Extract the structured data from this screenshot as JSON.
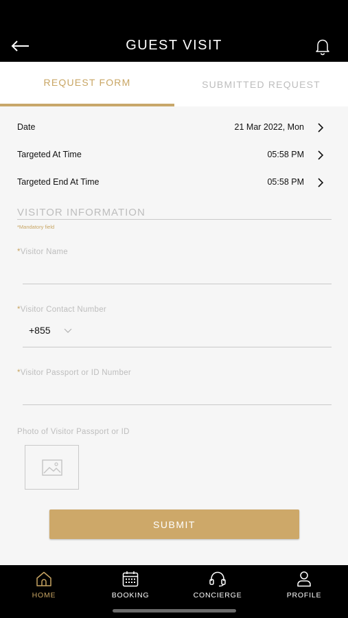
{
  "header": {
    "title": "GUEST VISIT",
    "back_icon": "arrow-left-icon",
    "bell_icon": "bell-icon"
  },
  "tabs": [
    {
      "label": "REQUEST FORM",
      "active": true
    },
    {
      "label": "SUBMITTED REQUEST",
      "active": false
    }
  ],
  "schedule": [
    {
      "label": "Date",
      "value": "21 Mar 2022, Mon"
    },
    {
      "label": "Targeted At Time",
      "value": "05:58 PM"
    },
    {
      "label": "Targeted End At Time",
      "value": "05:58 PM"
    }
  ],
  "visitor": {
    "section_title": "VISITOR INFORMATION",
    "mandatory_note": "*Mandatory field",
    "name_label": "Visitor Name",
    "contact_label": "Visitor Contact Number",
    "country_code": "+855",
    "passport_label": "Visitor Passport or ID Number",
    "photo_label": "Photo of Visitor Passport or ID",
    "required_marker": "*"
  },
  "submit_label": "SUBMIT",
  "nav": [
    {
      "label": "HOME",
      "icon": "home-icon",
      "active": true
    },
    {
      "label": "BOOKING",
      "icon": "calendar-icon",
      "active": false
    },
    {
      "label": "CONCIERGE",
      "icon": "headset-icon",
      "active": false
    },
    {
      "label": "PROFILE",
      "icon": "user-icon",
      "active": false
    }
  ],
  "colors": {
    "accent": "#c8a563",
    "button": "#cda869",
    "header_bg": "#000000",
    "page_bg": "#f6f6f6"
  }
}
